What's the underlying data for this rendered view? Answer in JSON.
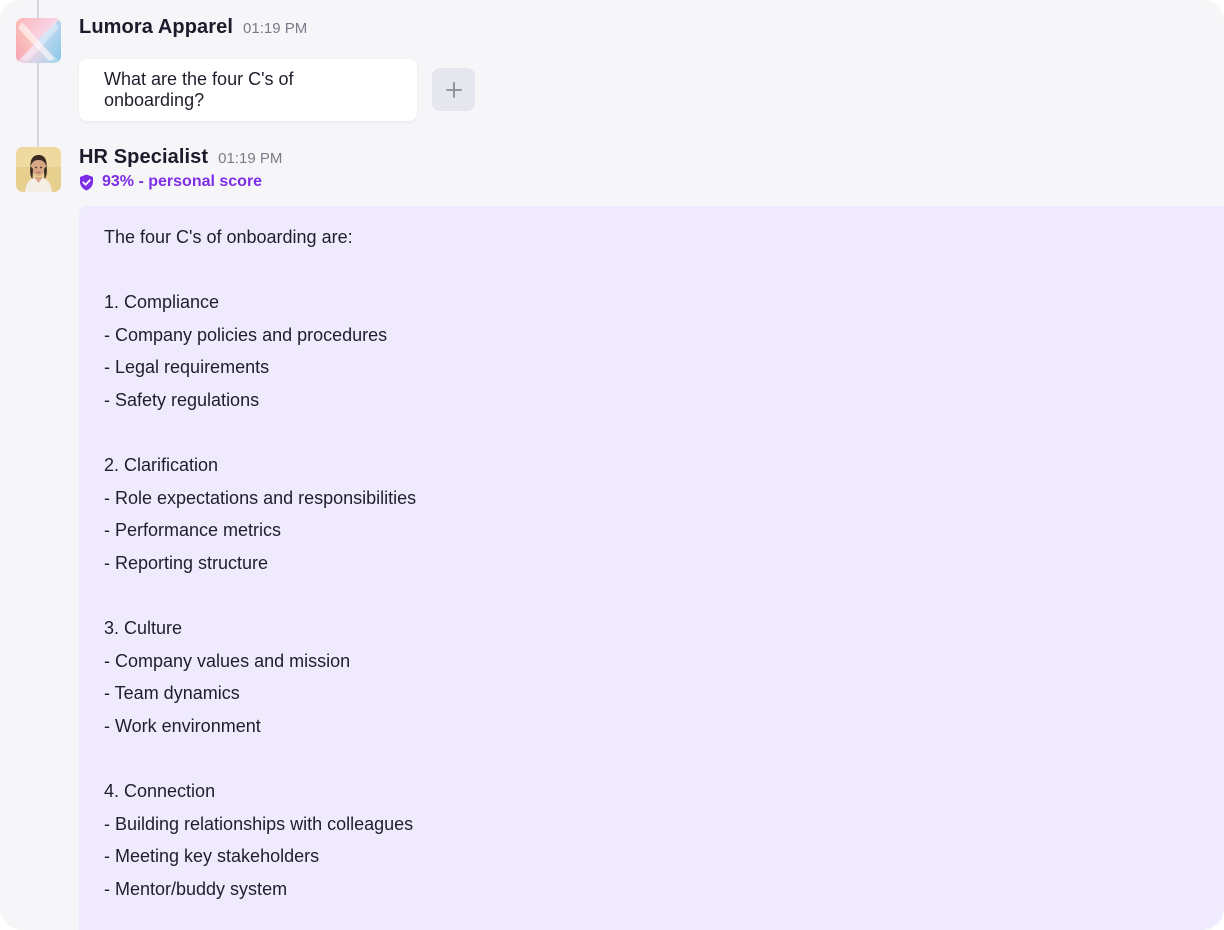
{
  "user_message": {
    "sender": "Lumora Apparel",
    "time": "01:19 PM",
    "text": "What are the four C's of onboarding?",
    "avatar_icon": "lumora-logo-icon",
    "add_icon": "plus-icon"
  },
  "reply": {
    "sender": "HR Specialist",
    "time": "01:19 PM",
    "score_icon": "verified-shield-icon",
    "score_label": "93% - personal score",
    "accent_color": "#7d2ee6",
    "bubble_color": "#efeafd",
    "lines": [
      "The four C's of onboarding are:",
      "",
      "1. Compliance",
      "- Company policies and procedures",
      "- Legal requirements",
      "- Safety regulations",
      "",
      "2. Clarification",
      "- Role expectations and responsibilities",
      "- Performance metrics",
      "- Reporting structure",
      "",
      "3. Culture",
      "- Company values and mission",
      "- Team dynamics",
      "- Work environment",
      "",
      "4. Connection",
      "- Building relationships with colleagues",
      "- Meeting key stakeholders",
      "- Mentor/buddy system"
    ]
  }
}
